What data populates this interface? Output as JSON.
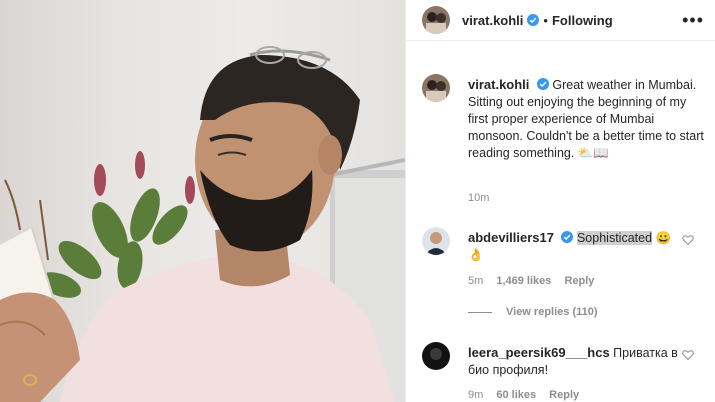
{
  "post": {
    "username": "virat.kohli",
    "separator": "•",
    "follow_status": "Following",
    "more_label": "•••",
    "caption": "Great weather in Mumbai. Sitting out enjoying the beginning of my first proper experience of Mumbai monsoon. Couldn't be a better time to start reading something.",
    "caption_emojis": "⛅📖",
    "time": "10m"
  },
  "comments": [
    {
      "username": "abdevilliers17",
      "text": "Sophisticated",
      "emojis": "😀 👌",
      "time": "5m",
      "likes": "1,469 likes",
      "reply": "Reply",
      "view_replies": "View replies (110)"
    },
    {
      "username": "leera_peersik69___hcs",
      "text": "Приватка в био профиля!",
      "time": "9m",
      "likes": "60 likes",
      "reply": "Reply"
    }
  ],
  "colors": {
    "verified": "#3897f0",
    "muted": "#8e8e8e",
    "text": "#262626"
  }
}
